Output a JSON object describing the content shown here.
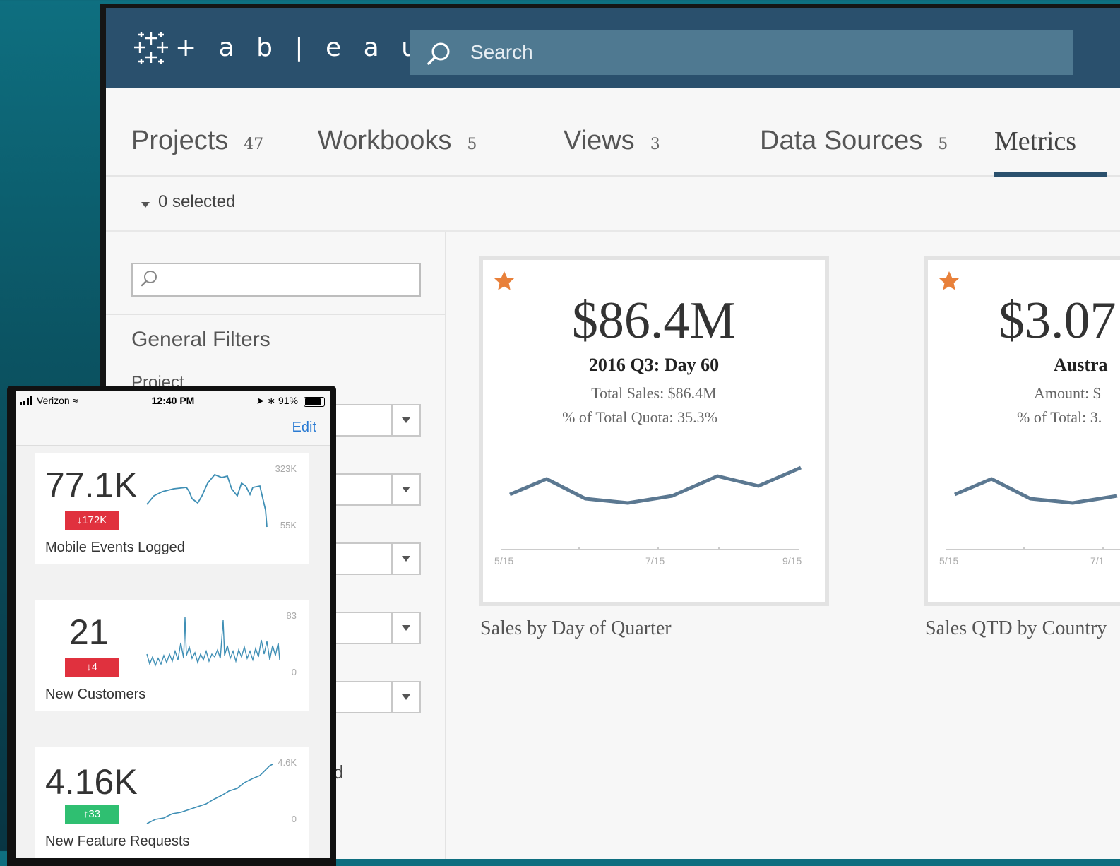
{
  "app": {
    "logo_text": "+ a b | e a u",
    "logo_icon": "tableau-plus-mark"
  },
  "search": {
    "placeholder": "Search",
    "icon": "search-icon"
  },
  "tabs": [
    {
      "label": "Projects",
      "count": "47"
    },
    {
      "label": "Workbooks",
      "count": "5"
    },
    {
      "label": "Views",
      "count": "3"
    },
    {
      "label": "Data Sources",
      "count": "5"
    },
    {
      "label": "Metrics",
      "count": ""
    }
  ],
  "selection": {
    "label": "0 selected"
  },
  "filters": {
    "heading": "General Filters",
    "project_label": "Project",
    "partial_label": "d"
  },
  "metric_cards": [
    {
      "value": "$86.4M",
      "line1": "2016 Q3: Day 60",
      "line2": "Total Sales: $86.4M",
      "line3": "% of Total Quota: 35.3%",
      "ticks": [
        "5/15",
        "7/15",
        "9/15"
      ],
      "caption": "Sales by Day of Quarter"
    },
    {
      "value": "$3.07",
      "line1": "Austra",
      "line2": "Amount: $",
      "line3": "% of Total: 3.",
      "ticks": [
        "5/15",
        "7/1"
      ],
      "caption": "Sales QTD by Country"
    }
  ],
  "phone": {
    "carrier": "Verizon",
    "time": "12:40 PM",
    "battery": "91%",
    "nav_edit": "Edit",
    "cards": [
      {
        "value": "77.1K",
        "delta": "↓172K",
        "delta_color": "#e0313e",
        "name": "Mobile Events Logged",
        "max": "323K",
        "min": "55K"
      },
      {
        "value": "21",
        "delta": "↓4",
        "delta_color": "#e0313e",
        "name": "New Customers",
        "max": "83",
        "min": "0"
      },
      {
        "value": "4.16K",
        "delta": "↑33",
        "delta_color": "#2fbf71",
        "name": "New Feature Requests",
        "max": "4.6K",
        "min": "0"
      }
    ]
  },
  "colors": {
    "topbar": "#2a506d",
    "search_bg": "#4f7991",
    "star": "#e8803a",
    "line": "#5b7891",
    "spark": "#3f8fb5"
  }
}
